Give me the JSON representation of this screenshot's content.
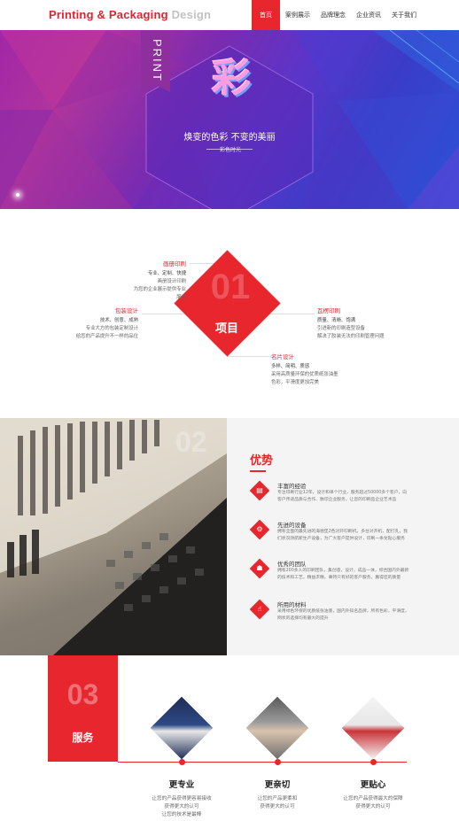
{
  "header": {
    "logo_primary": "Printing & Packaging",
    "logo_secondary": "Design",
    "nav": [
      "首页",
      "案例展示",
      "品牌理念",
      "企业资讯",
      "关于我们"
    ],
    "active_index": 0
  },
  "hero": {
    "tab_text": "PRINT",
    "char": "彩",
    "slogan": "焕变的色彩 不变的美丽",
    "sub": "彩色时光"
  },
  "projects": {
    "number": "01",
    "label": "项目",
    "items": [
      {
        "title": "画册印刷",
        "keywords": "专业、定制、快捷",
        "desc1": "画册设计印刷",
        "desc2": "为您的企业展示提供专业服务"
      },
      {
        "title": "包装设计",
        "keywords": "技术、创意、成熟",
        "desc1": "专业大方的包装定制设计",
        "desc2": "给您的产品提升不一样的品位"
      },
      {
        "title": "瓦楞印刷",
        "keywords": "质量、清晰、饱满",
        "desc1": "引进新的印刷造型设备",
        "desc2": "解决了胶装无法的印刷管理问题"
      },
      {
        "title": "名片设计",
        "keywords": "多样、简明、质感",
        "desc1": "采用高质量环保的优质纸张油墨",
        "desc2": "色彩，平滑度更加完美"
      }
    ]
  },
  "advantages": {
    "number": "02",
    "title": "优势",
    "items": [
      {
        "icon": "book-icon",
        "title": "丰富的经验",
        "desc": "专注印刷行业12年，设计和单个行业，服务超过50000多个客户，向客户传递品质与合作、数印企业服务，让您的印刷品企业艺术品"
      },
      {
        "icon": "gear-icon",
        "title": "先进的设备",
        "desc": "拥有全面的最先进的海德堡2色对开印刷机，多台对开机，配打孔，我们状况领航新生产设备，为广大客户提供设计，印刷一条龙贴心服务"
      },
      {
        "icon": "team-icon",
        "title": "优秀的团队",
        "desc": "拥有200多人的印刷团队，集创意，设计，成品一体，综合国内外最新的技术和工艺，精益求精，秉持只有好的客户服务，赢得您的质量"
      },
      {
        "icon": "thumb-icon",
        "title": "所用的材料",
        "desc": "采用绿色环保的优质纸张油墨，国内外知名品牌，所有色彩，平滑度，网状的选择均有最大的提升"
      }
    ]
  },
  "service": {
    "number": "03",
    "title": "服务",
    "items": [
      {
        "icon": "suit-icon",
        "title": "更专业",
        "desc1": "让您的产品获得更容易接收",
        "desc2": "获得更大的认可",
        "desc3": "让您的技术是最棒"
      },
      {
        "icon": "handshake-icon",
        "title": "更亲切",
        "desc1": "让您的产品更柔和",
        "desc2": "获得更大的认可",
        "desc3": ""
      },
      {
        "icon": "gift-icon",
        "title": "更贴心",
        "desc1": "让您的产品获得最大的保障",
        "desc2": "获得更大的认可",
        "desc3": ""
      }
    ]
  },
  "colors": {
    "accent": "#e7262e",
    "logo_grey": "#c2c2c2",
    "hero_purple": "#7a2bb0",
    "hero_blue": "#2a53d6"
  }
}
